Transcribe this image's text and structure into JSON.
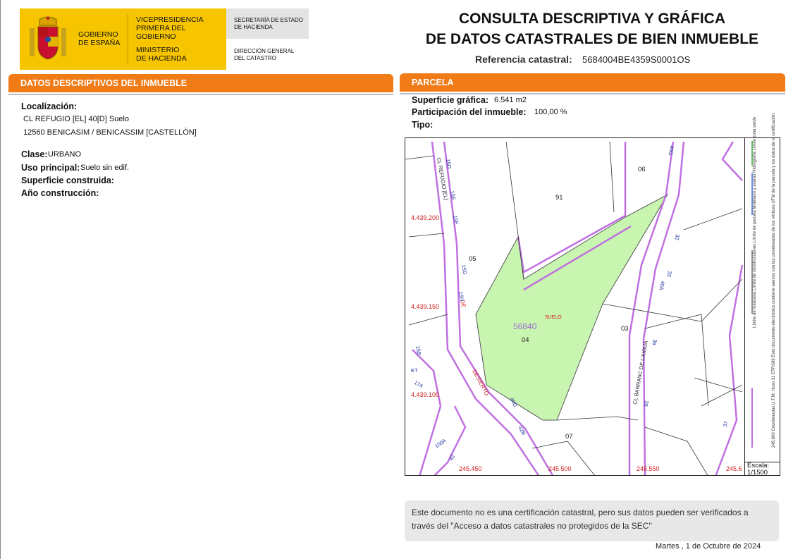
{
  "header": {
    "gov_name": [
      "GOBIERNO",
      "DE ESPAÑA"
    ],
    "vicepresidencia": [
      "VICEPRESIDENCIA",
      "PRIMERA DEL GOBIERNO"
    ],
    "ministerio": [
      "MINISTERIO",
      "DE HACIENDA"
    ],
    "secretaria": [
      "SECRETARÍA DE ESTADO",
      "DE HACIENDA"
    ],
    "direccion": [
      "DIRECCIÓN GENERAL",
      "DEL CATASTRO"
    ],
    "title_line1": "CONSULTA DESCRIPTIVA Y GRÁFICA",
    "title_line2": "DE DATOS CATASTRALES DE BIEN INMUEBLE",
    "ref_label": "Referencia catastral:",
    "ref_value": "5684004BE4359S0001OS"
  },
  "descriptivos": {
    "heading": "DATOS DESCRIPTIVOS DEL INMUEBLE",
    "localizacion_label": "Localización:",
    "localizacion_line1": "CL REFUGIO [EL] 40[D] Suelo",
    "localizacion_line2": "12560 BENICASIM / BENICASSIM [CASTELLÓN]",
    "clase_label": "Clase:",
    "clase_value": "URBANO",
    "uso_label": "Uso principal:",
    "uso_value": "Suelo sin edif.",
    "superficie_label": "Superficie construida:",
    "anio_label": "Año construcción:"
  },
  "parcela": {
    "heading": "PARCELA",
    "sup_label": "Superficie gráfica:",
    "sup_value": "6.541 m2",
    "part_label": "Participación del inmueble:",
    "part_value": "100,00 %",
    "tipo_label": "Tipo:"
  },
  "map": {
    "parcel_number": "56840",
    "parcel_use": "SUELO",
    "parcel_id": "04",
    "neighbors": [
      "91",
      "06",
      "05",
      "03",
      "07"
    ],
    "coord_y": [
      "4.439.200",
      "4.439.150",
      "4.439.100"
    ],
    "coord_x": [
      "245.450",
      "245.500",
      "245.550",
      "245.6"
    ],
    "street_labels": [
      "CL REFUGIO [EL]",
      "CL BARRANC DE L'AIGUA",
      "DESIERTO",
      "DE"
    ],
    "numbers": [
      "15D",
      "15E",
      "15F",
      "15G",
      "15H",
      "40G",
      "32",
      "33",
      "40A",
      "36",
      "38",
      "40D",
      "42B",
      "15B",
      "17A",
      "100A",
      "42",
      "37",
      "ET"
    ],
    "legend": "Límite de manzana   Límite de construcciones   Límite de parcela   Mobiliario y aceras   Hidrografía   Límite zona verde",
    "legend2": "245,600 Coordenadas U.T.M. Huso 31 ETRS89   Este documento electrónico contiene anexos con las coordenadas de los vértices UTM de la parcela y los datos de la certificación",
    "scale_label": "Escala:",
    "scale_value": "1/1500",
    "colors": {
      "parcel_fill": "#c8f5b0",
      "street": "#c070e0",
      "coord": "#d02020"
    }
  },
  "footer": {
    "note": "Este documento no es una certificación catastral, pero sus datos pueden ser verificados a través del \"Acceso a datos catastrales no protegidos de la SEC\"",
    "date": "Martes , 1 de Octubre de 2024"
  }
}
